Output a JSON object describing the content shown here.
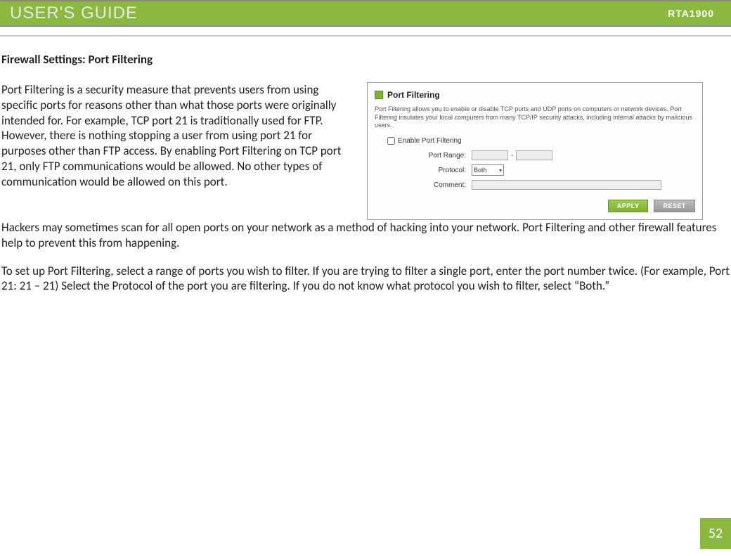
{
  "header": {
    "title": "USER'S GUIDE",
    "model": "RTA1900"
  },
  "section_title": "Firewall Settings: Port Filtering",
  "para1": "Port Filtering is a security measure that prevents users from using specific ports for reasons other than what those ports were originally intended for.  For example, TCP port 21 is traditionally used for FTP.  However, there is nothing stopping a user from using port 21 for purposes other than FTP access.  By enabling Port Filtering on TCP port 21, only FTP communications would be allowed.  No other types of communication would be allowed on this port.",
  "para2": "Hackers may sometimes scan for all open ports on your network as a method of hacking into your network.  Port Filtering and other firewall features help to prevent this from happening.",
  "para3": "To set up Port Filtering, select a range of ports you wish to filter.  If you are trying to filter a single port, enter the port number twice.  (For example, Port 21:  21 – 21) Select the Protocol of the port you are filtering.  If you do not know what protocol you wish to filter, select “Both.”",
  "panel": {
    "title": "Port Filtering",
    "desc": "Port Filtering allows you to enable or disable TCP ports and UDP ports on computers or network devices. Port Filtering insulates your local computers from many TCP/IP security attacks, including internal attacks by malicious users.",
    "enable_label": "Enable Port Filtering",
    "labels": {
      "port_range": "Port Range:",
      "protocol": "Protocol:",
      "comment": "Comment:"
    },
    "protocol_value": "Both",
    "btn_apply": "APPLY",
    "btn_reset": "RESET"
  },
  "page_number": "52"
}
